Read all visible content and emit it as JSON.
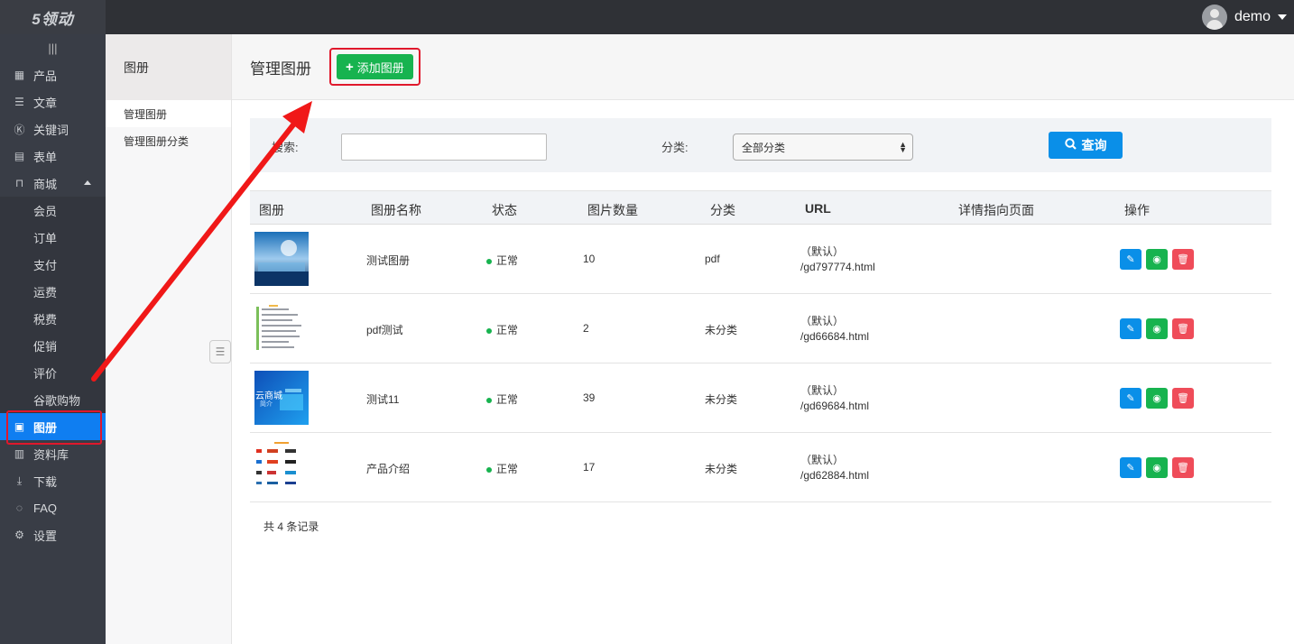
{
  "app": {
    "logo_text": "5领动",
    "user_name": "demo"
  },
  "sidebar": {
    "toggle": "|||",
    "items": [
      {
        "label": "产品",
        "icon": "grid-icon"
      },
      {
        "label": "文章",
        "icon": "document-icon"
      },
      {
        "label": "关键词",
        "icon": "keyword-icon"
      },
      {
        "label": "表单",
        "icon": "form-icon"
      },
      {
        "label": "商城",
        "icon": "shop-icon"
      },
      {
        "label": "会员"
      },
      {
        "label": "订单"
      },
      {
        "label": "支付"
      },
      {
        "label": "运费"
      },
      {
        "label": "税费"
      },
      {
        "label": "促销"
      },
      {
        "label": "评价"
      },
      {
        "label": "谷歌购物"
      },
      {
        "label": "图册",
        "icon": "image-icon"
      },
      {
        "label": "资料库",
        "icon": "library-icon"
      },
      {
        "label": "下载",
        "icon": "download-icon"
      },
      {
        "label": "FAQ",
        "icon": "chat-icon"
      },
      {
        "label": "设置",
        "icon": "settings-icon"
      }
    ]
  },
  "subnav": {
    "title": "图册",
    "items": [
      "管理图册",
      "管理图册分类"
    ]
  },
  "main": {
    "title": "管理图册",
    "add_button": "添加图册",
    "search": {
      "keyword_label": "搜索:",
      "category_label": "分类:",
      "category_selected": "全部分类",
      "search_button": "查询"
    },
    "table": {
      "headers": [
        "图册",
        "图册名称",
        "状态",
        "图片数量",
        "分类",
        "URL",
        "详情指向页面",
        "操作"
      ],
      "rows": [
        {
          "name": "测试图册",
          "status": "正常",
          "count": "10",
          "category": "pdf",
          "url_default": "（默认）",
          "url": "/gd797774.html",
          "detail": ""
        },
        {
          "name": "pdf测试",
          "status": "正常",
          "count": "2",
          "category": "未分类",
          "url_default": "（默认）",
          "url": "/gd66684.html",
          "detail": ""
        },
        {
          "name": "测试11",
          "status": "正常",
          "count": "39",
          "category": "未分类",
          "url_default": "（默认）",
          "url": "/gd69684.html",
          "detail": ""
        },
        {
          "name": "产品介绍",
          "status": "正常",
          "count": "17",
          "category": "未分类",
          "url_default": "（默认）",
          "url": "/gd62884.html",
          "detail": ""
        }
      ],
      "thumb_texts": [
        "云商城",
        "简介"
      ]
    },
    "total": "共 4 条记录"
  },
  "colors": {
    "accent": "#0f7ef1",
    "success": "#17b34f",
    "danger": "#ef4c59",
    "highlight": "#e0182c"
  }
}
